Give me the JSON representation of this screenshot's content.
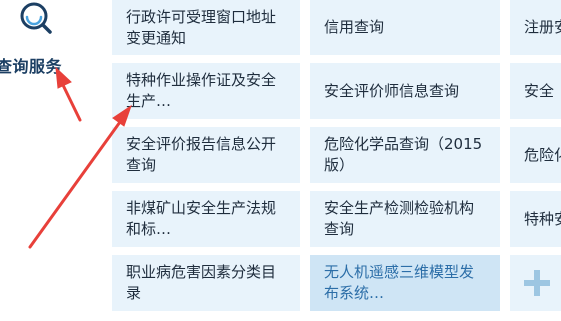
{
  "section": {
    "title": "查询服务",
    "icon": "search-icon"
  },
  "tiles": [
    [
      "行政许可受理窗口地址变更通知",
      "信用查询",
      "注册安"
    ],
    [
      "特种作业操作证及安全生产…",
      "安全评价师信息查询",
      "安全"
    ],
    [
      "安全评价报告信息公开查询",
      "危险化学品查询（2015版）",
      "危险化"
    ],
    [
      "非煤矿山安全生产法规和标…",
      "安全生产检测检验机构查询",
      "特种安"
    ],
    [
      "职业病危害因素分类目录",
      "无人机遥感三维模型发布系统…",
      ""
    ]
  ],
  "more_button": "plus-icon",
  "colors": {
    "tile_bg": "#e8f3fb",
    "tile_highlight_bg": "#cfe5f5",
    "highlight_text": "#2c6ea8",
    "title": "#1c3f63",
    "annotation_arrow": "#e8403a"
  }
}
